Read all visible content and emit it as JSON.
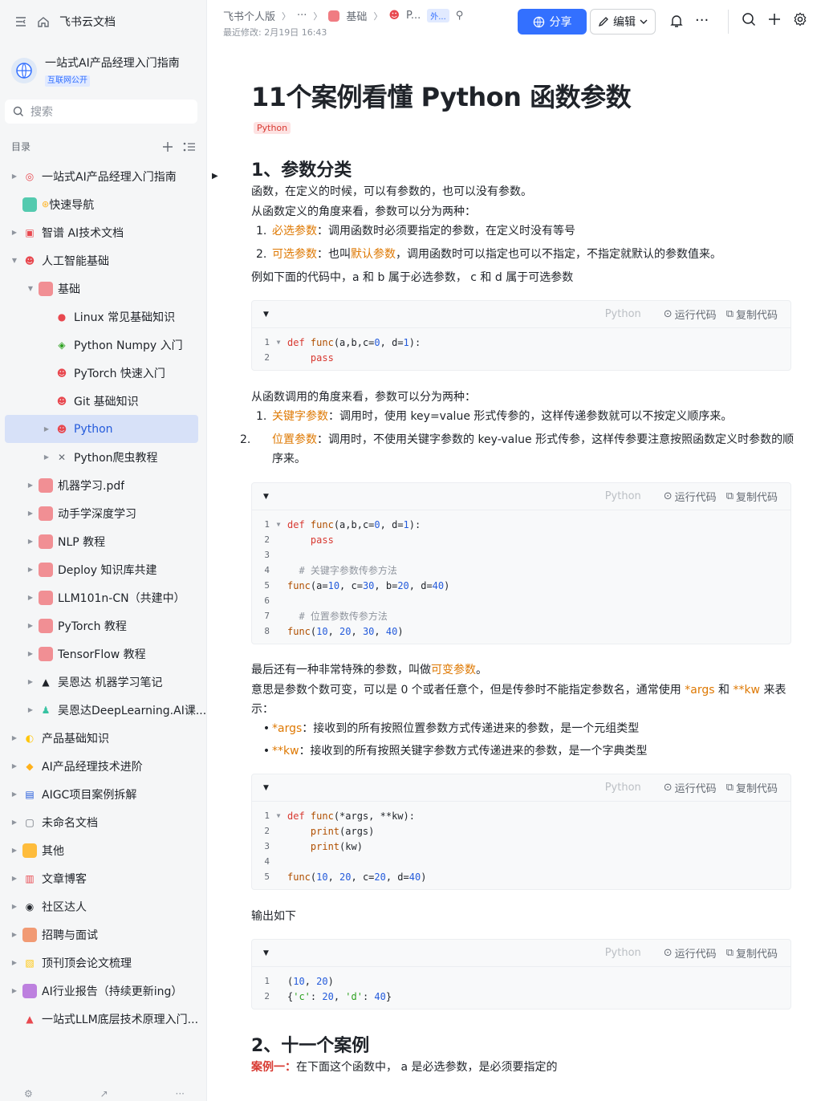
{
  "app": {
    "home_label": "飞书云文档"
  },
  "knowledge_base": {
    "title": "一站式AI产品经理入门指南",
    "badge": "互联网公开"
  },
  "search": {
    "placeholder": "搜索"
  },
  "toc": {
    "heading": "目录"
  },
  "tree": [
    {
      "label": "一站式AI产品经理入门指南",
      "level": 0,
      "caret": "right",
      "icon": "target-icon",
      "color": "#e8484f"
    },
    {
      "label": "快速导航",
      "level": 0,
      "caret": "none",
      "icon": "nav-icon",
      "color": "#37c2a2",
      "pre": "⊛"
    },
    {
      "label": "智谱 AI技术文档",
      "level": 0,
      "caret": "right",
      "icon": "calendar-icon",
      "color": "#e8484f"
    },
    {
      "label": "人工智能基础",
      "level": 0,
      "caret": "down",
      "icon": "emoji-icon",
      "color": "#e8484f"
    },
    {
      "label": "基础",
      "level": 1,
      "caret": "down",
      "icon": "grid-icon",
      "color": "#f07c82"
    },
    {
      "label": "Linux 常见基础知识",
      "level": 2,
      "caret": "none",
      "icon": "apple-icon",
      "color": "#e8484f"
    },
    {
      "label": "Python Numpy 入门",
      "level": 2,
      "caret": "none",
      "icon": "numpy-icon",
      "color": "#2ea121"
    },
    {
      "label": "PyTorch 快速入门",
      "level": 2,
      "caret": "none",
      "icon": "emoji-icon",
      "color": "#e8484f"
    },
    {
      "label": "Git 基础知识",
      "level": 2,
      "caret": "none",
      "icon": "emoji-icon",
      "color": "#e8484f"
    },
    {
      "label": "Python",
      "level": 2,
      "caret": "right",
      "icon": "emoji-icon",
      "color": "#e8484f",
      "active": true
    },
    {
      "label": "Python爬虫教程",
      "level": 2,
      "caret": "right",
      "icon": "tools-icon",
      "color": "#646a73"
    },
    {
      "label": "机器学习.pdf",
      "level": 1,
      "caret": "right",
      "icon": "grid-icon",
      "color": "#f07c82"
    },
    {
      "label": "动手学深度学习",
      "level": 1,
      "caret": "right",
      "icon": "grid-icon",
      "color": "#f07c82"
    },
    {
      "label": "NLP 教程",
      "level": 1,
      "caret": "right",
      "icon": "grid-icon",
      "color": "#f07c82"
    },
    {
      "label": "Deploy 知识库共建",
      "level": 1,
      "caret": "right",
      "icon": "grid-icon",
      "color": "#f07c82"
    },
    {
      "label": "LLM101n-CN（共建中）",
      "level": 1,
      "caret": "right",
      "icon": "grid-icon",
      "color": "#f07c82"
    },
    {
      "label": "PyTorch 教程",
      "level": 1,
      "caret": "right",
      "icon": "grid-icon",
      "color": "#f07c82"
    },
    {
      "label": "TensorFlow 教程",
      "level": 1,
      "caret": "right",
      "icon": "grid-icon",
      "color": "#f07c82"
    },
    {
      "label": "吴恩达 机器学习笔记",
      "level": 1,
      "caret": "right",
      "icon": "graduation-icon",
      "color": "#1f2329"
    },
    {
      "label": "吴恩达DeepLearning.AI课...",
      "level": 1,
      "caret": "right",
      "icon": "teacher-icon",
      "color": "#37c2a2"
    },
    {
      "label": "产品基础知识",
      "level": 0,
      "caret": "right",
      "icon": "banana-icon",
      "color": "#ffc60a"
    },
    {
      "label": "AI产品经理技术进阶",
      "level": 0,
      "caret": "right",
      "icon": "muscle-icon",
      "color": "#ffb11b"
    },
    {
      "label": "AIGC项目案例拆解",
      "level": 0,
      "caret": "right",
      "icon": "floppy-icon",
      "color": "#245bdb"
    },
    {
      "label": "未命名文档",
      "level": 0,
      "caret": "right",
      "icon": "doc-icon",
      "color": "#646a73"
    },
    {
      "label": "其他",
      "level": 0,
      "caret": "right",
      "icon": "box-icon",
      "color": "#ffb11b"
    },
    {
      "label": "文章博客",
      "level": 0,
      "caret": "right",
      "icon": "page-icon",
      "color": "#e8484f"
    },
    {
      "label": "社区达人",
      "level": 0,
      "caret": "right",
      "icon": "eyes-icon",
      "color": "#1f2329"
    },
    {
      "label": "招聘与面试",
      "level": 0,
      "caret": "right",
      "icon": "grid-icon",
      "color": "#f08a5d"
    },
    {
      "label": "顶刊顶会论文梳理",
      "level": 0,
      "caret": "right",
      "icon": "scroll-icon",
      "color": "#ffc60a"
    },
    {
      "label": "AI行业报告（持续更新ing）",
      "level": 0,
      "caret": "right",
      "icon": "grid-icon",
      "color": "#b36bdb"
    },
    {
      "label": "一站式LLM底层技术原理入门...",
      "level": 0,
      "caret": "none",
      "icon": "flask-icon",
      "color": "#e8484f"
    }
  ],
  "header": {
    "crumbs": [
      "飞书个人版",
      "···",
      "基础",
      "P..."
    ],
    "external_tag": "外...",
    "modified": "最近修改: 2月19日 16:43",
    "share": "分享",
    "edit": "编辑"
  },
  "doc": {
    "title": "11个案例看懂 Python 函数参数",
    "tag": "Python",
    "sec1": "1、参数分类",
    "p1": "函数，在定义的时候，可以有参数的，也可以没有参数。",
    "p2": "从函数定义的角度来看，参数可以分为两种：",
    "l1_num": "1.",
    "l1_hl": "必选参数",
    "l1_rest": "：调用函数时必须要指定的参数，在定义时没有等号",
    "l2_num": "2.",
    "l2_hl": "可选参数",
    "l2_mid": "：也叫",
    "l2_hl2": "默认参数",
    "l2_rest": "，调用函数时可以指定也可以不指定，不指定就默认的参数值来。",
    "p3": "例如下面的代码中，a 和 b 属于必选参数， c 和 d 属于可选参数",
    "p4": "从函数调用的角度来看，参数可以分为两种：",
    "l3_num": "1.",
    "l3_hl": "关键字参数",
    "l3_rest": "：调用时，使用 key=value 形式传参的，这样传递参数就可以不按定义顺序来。",
    "l4_num": "2.",
    "l4_hl": "位置参数",
    "l4_rest": "：调用时，不使用关键字参数的 key-value 形式传参，这样传参要注意按照函数定义时参数的顺序来。",
    "p5_a": "最后还有一种非常特殊的参数，叫做",
    "p5_hl": "可变参数",
    "p5_b": "。",
    "p6_a": "意思是参数个数可变，可以是 0 个或者任意个，但是传参时不能指定参数名，通常使用 ",
    "p6_hl1": "*args",
    "p6_mid": " 和 ",
    "p6_hl2": "**kw",
    "p6_b": " 来表示：",
    "b1_hl": "*args",
    "b1_rest": "：接收到的所有按照位置参数方式传递进来的参数，是一个元组类型",
    "b2_hl": "**kw",
    "b2_rest": "：接收到的所有按照关键字参数方式传递进来的参数，是一个字典类型",
    "p7": "输出如下",
    "sec2": "2、十一个案例",
    "p8_hl": "案例一：",
    "p8_rest": "在下面这个函数中， a 是必选参数，是必须要指定的"
  },
  "code_ui": {
    "lang": "Python",
    "run": "运行代码",
    "copy": "复制代码"
  },
  "code1": [
    "def func(a,b,c=0, d=1):",
    "    pass"
  ],
  "code2": [
    "def func(a,b,c=0, d=1):",
    "    pass",
    "",
    "  # 关键字参数传参方法",
    "func(a=10, c=30, b=20, d=40)",
    "",
    "  # 位置参数传参方法",
    "func(10, 20, 30, 40)"
  ],
  "code3": [
    "def func(*args, **kw):",
    "    print(args)",
    "    print(kw)",
    "",
    "func(10, 20, c=20, d=40)"
  ],
  "code4": [
    "(10, 20)",
    "{'c': 20, 'd': 40}"
  ]
}
